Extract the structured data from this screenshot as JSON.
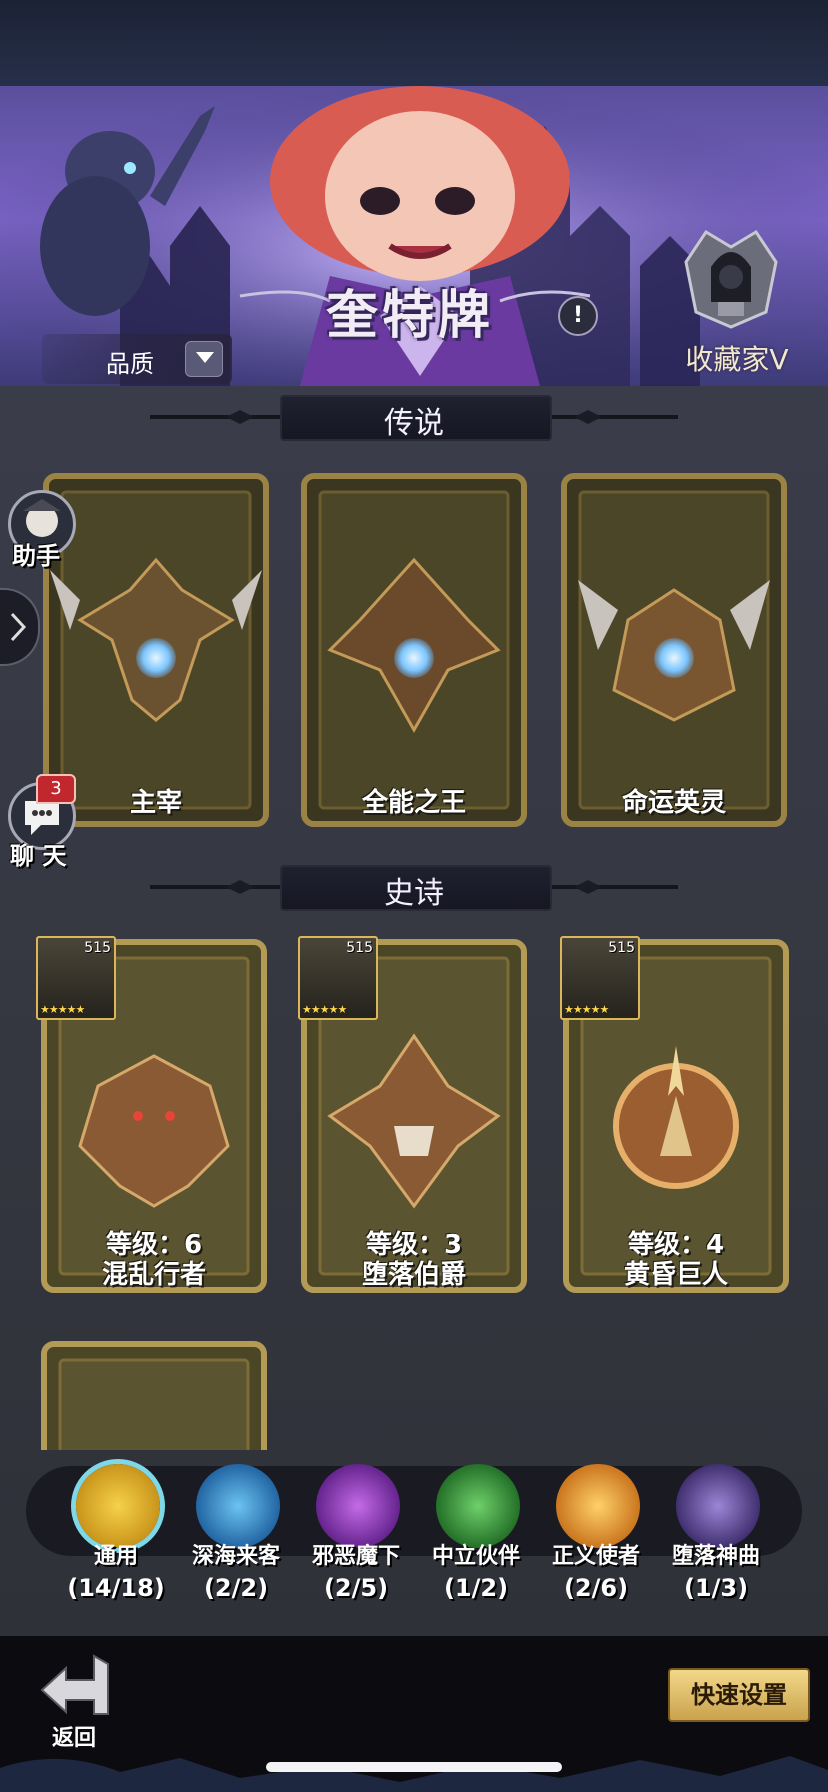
{
  "header": {
    "title": "奎特牌",
    "quality_label": "品质",
    "collector_label": "收藏家V"
  },
  "sections": [
    {
      "title": "传说",
      "cards": [
        {
          "name": "主宰",
          "state": "locked"
        },
        {
          "name": "全能之王",
          "state": "locked"
        },
        {
          "name": "命运英灵",
          "state": "locked"
        }
      ]
    },
    {
      "title": "史诗",
      "cards": [
        {
          "name": "混乱行者",
          "level_text": "等级：6",
          "hero_level": "515",
          "hero_stars": "★★★★★"
        },
        {
          "name": "堕落伯爵",
          "level_text": "等级：3",
          "hero_level": "515",
          "hero_stars": "★★★★★"
        },
        {
          "name": "黄昏巨人",
          "level_text": "等级：4",
          "hero_level": "515",
          "hero_stars": "★★★★★"
        }
      ]
    }
  ],
  "side_buttons": {
    "assistant_label": "助手",
    "chat_label": "聊 天",
    "chat_badge": "3"
  },
  "factions": [
    {
      "name": "通用",
      "count": "(14/18)",
      "color": "#f2c133",
      "selected": true
    },
    {
      "name": "深海来客",
      "count": "(2/2)",
      "color": "#3a8fd9",
      "selected": false
    },
    {
      "name": "邪恶魔下",
      "count": "(2/5)",
      "color": "#8e3bb8",
      "selected": false
    },
    {
      "name": "中立伙伴",
      "count": "(1/2)",
      "color": "#3c9a3a",
      "selected": false
    },
    {
      "name": "正义使者",
      "count": "(2/6)",
      "color": "#e29a1e",
      "selected": false
    },
    {
      "name": "堕落神曲",
      "count": "(1/3)",
      "color": "#6a4fa3",
      "selected": false
    }
  ],
  "bottom": {
    "back_label": "返回",
    "quick_setup_label": "快速设置"
  },
  "icons": {
    "info": "!",
    "expand": "chevron-right-icon"
  }
}
